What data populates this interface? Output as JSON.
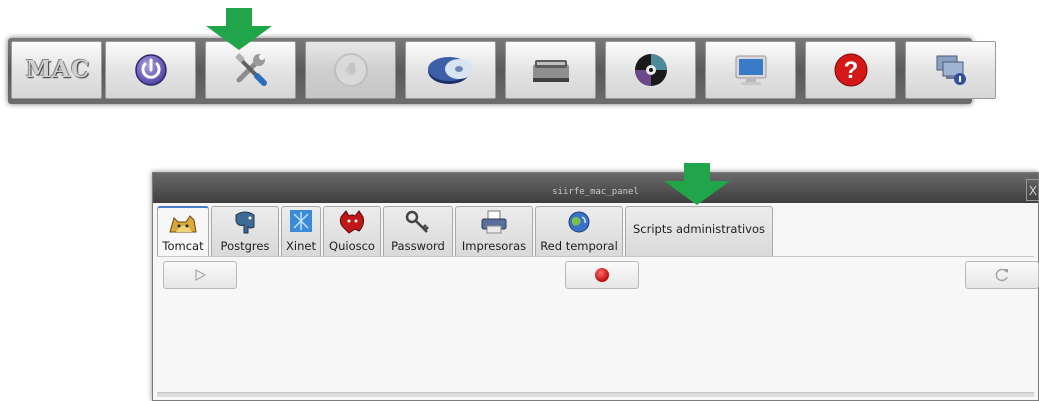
{
  "toolbar": {
    "brand_label": "MAC",
    "buttons": [
      {
        "name": "mac-logo",
        "icon": "mac-text-icon"
      },
      {
        "name": "power-button",
        "icon": "power-icon"
      },
      {
        "name": "tools-button",
        "icon": "wrench-screwdriver-icon"
      },
      {
        "name": "disc-button",
        "icon": "disc-faded-icon"
      },
      {
        "name": "optical-drive-button",
        "icon": "cd-drive-icon"
      },
      {
        "name": "scanner-button",
        "icon": "scanner-icon"
      },
      {
        "name": "cd-dvd-button",
        "icon": "dvd-icon"
      },
      {
        "name": "monitor-button",
        "icon": "monitor-icon"
      },
      {
        "name": "help-button",
        "icon": "question-icon"
      },
      {
        "name": "network-button",
        "icon": "network-computers-icon"
      }
    ]
  },
  "window": {
    "title": "siirfe_mac_panel",
    "close_glyph": "X",
    "tabs": [
      {
        "label": "Tomcat",
        "icon": "tomcat-icon",
        "active": true
      },
      {
        "label": "Postgres",
        "icon": "elephant-icon"
      },
      {
        "label": "Xinet",
        "icon": "xinet-icon"
      },
      {
        "label": "Quiosco",
        "icon": "devil-icon"
      },
      {
        "label": "Password",
        "icon": "keys-icon"
      },
      {
        "label": "Impresoras",
        "icon": "printer-icon"
      },
      {
        "label": "Red temporal",
        "icon": "globe-icon"
      },
      {
        "label": "Scripts administrativos",
        "icon": ""
      }
    ],
    "controls": {
      "start": "play-icon",
      "stop": "record-stop-icon",
      "refresh": "refresh-icon"
    }
  },
  "colors": {
    "arrow": "#20a54a",
    "toolbar_bg": "#6a6a6a",
    "active_tab_accent": "#4a7bc8",
    "stop_red": "#d01010"
  }
}
